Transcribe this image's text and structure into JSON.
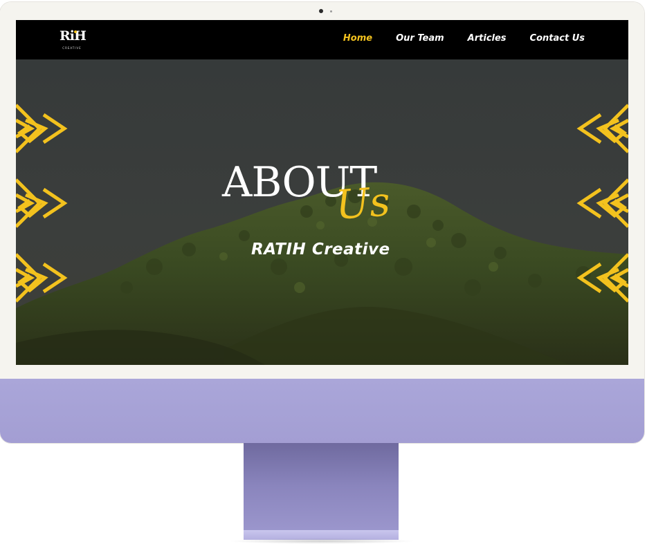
{
  "brand": {
    "logo_mark": "RiH",
    "logo_sub": "CREATIVE"
  },
  "nav": {
    "items": [
      {
        "label": "Home",
        "active": true
      },
      {
        "label": "Our Team",
        "active": false
      },
      {
        "label": "Articles",
        "active": false
      },
      {
        "label": "Contact Us",
        "active": false
      }
    ]
  },
  "hero": {
    "title": "ABOUT",
    "title_script": "Us",
    "subtitle": "RATIH Creative"
  },
  "colors": {
    "accent": "#f3c21e",
    "navbar": "#000000",
    "chin": "#a9a5d8"
  },
  "icons": {
    "decor": "yellow-tribal-pattern-icon"
  }
}
